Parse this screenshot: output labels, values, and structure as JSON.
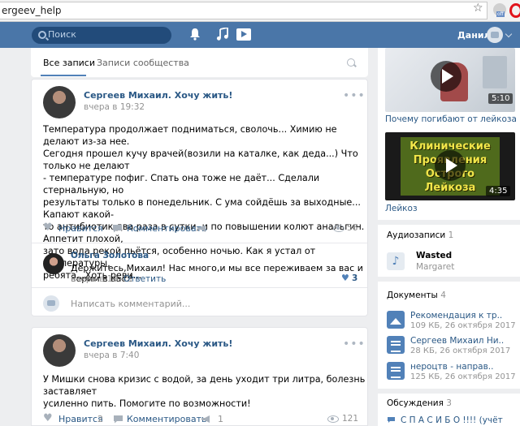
{
  "browser": {
    "url": "ergeev_help",
    "ext_badge": "off"
  },
  "header": {
    "search_placeholder": "Поиск",
    "user_name": "Данил"
  },
  "feed": {
    "tabs": [
      "Все записи",
      "Записи сообщества"
    ],
    "posts": [
      {
        "author": "Сергеев Михаил. Хочу жить!",
        "date": "вчера в 19:32",
        "lines": [
          "Температура продолжает подниматься, сволочь... Химию не делают из-за нее.",
          "Сегодня прошел кучу врачей(возили на каталке, как деда...) Что только не делают",
          "- температуре пофиг. Спать она тоже не даёт... Сделали стернальную, но",
          "результаты только в понедельник. С ума сойдёшь за выходные... Капают какой-",
          "то антибиотик два раза в сутки, и по повышении колют анальгин. Аппетит плохой,",
          "зато вода рекой пьётся, особенно ночью. Как я устал от температуры,",
          "ребята...Хоть реви..."
        ],
        "like_label": "Нравится",
        "comment_label": "Комментировать",
        "views": "56"
      },
      {
        "author": "Сергеев Михаил. Хочу жить!",
        "date": "вчера в 7:40",
        "lines": [
          "У Мишки снова кризис с водой, за день уходит три литра, болезнь заставляет",
          "усиленно пить. Помогите по возможности!"
        ],
        "like_label": "Нравится",
        "like_count": "2",
        "comment_label": "Комментировать",
        "comment_count": "1",
        "views": "121"
      }
    ],
    "comment": {
      "author": "Ольга Золотова",
      "text": "Держитесь,Михаил! Нас много,и мы все переживаем за вас и верим в вас !",
      "date": "вчера в 19:42",
      "reply": "Ответить",
      "likes": "3"
    },
    "comment_placeholder": "Написать комментарий..."
  },
  "sidebar": {
    "video1": {
      "caption": "Почему погибают от лейкоза",
      "duration": "5:10"
    },
    "video2": {
      "caption": "Лейкоз",
      "duration": "4:35",
      "title_lines": [
        "Клинические",
        "Проявления",
        "Острого",
        "Лейкоза"
      ]
    },
    "audio": {
      "heading": "Аудиозаписи",
      "count": "1",
      "title": "Wasted",
      "artist": "Margaret"
    },
    "documents": {
      "heading": "Документы",
      "count": "4",
      "items": [
        {
          "name": "Рекомендация к тр..",
          "meta": "109 КБ, 26 октября 2017",
          "icon": "image-doc-icon"
        },
        {
          "name": "Сергеев Михаил Ни..",
          "meta": "28 КБ, 26 октября 2017",
          "icon": "text-doc-icon"
        },
        {
          "name": "нероцтв - направ..",
          "meta": "125 КБ, 26 октября 2017",
          "icon": "text-doc-icon"
        }
      ]
    },
    "discussions": {
      "heading": "Обсуждения",
      "count": "3",
      "first": "С П А С И Б О !!!! (учёт"
    }
  },
  "colors": {
    "header": "#4a76a8",
    "link": "#2a5885",
    "accent": "#5181b8"
  }
}
